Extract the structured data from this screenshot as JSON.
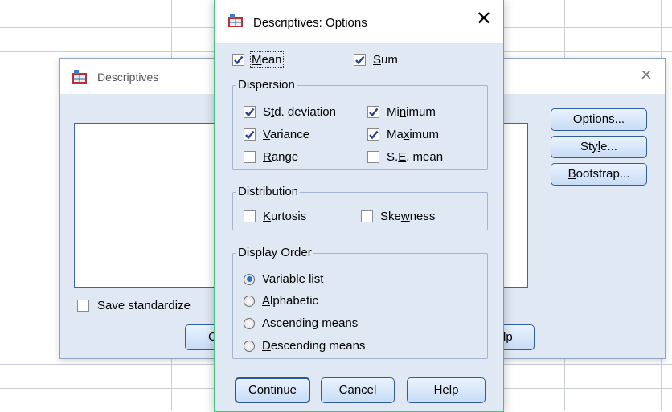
{
  "descriptives": {
    "title": "Descriptives",
    "save_standardized_label": "Save standardize",
    "buttons": {
      "options": {
        "pre": "",
        "ul": "O",
        "post": "ptions..."
      },
      "style": {
        "pre": "Sty",
        "ul": "l",
        "post": "e..."
      },
      "bootstrap": {
        "pre": "",
        "ul": "B",
        "post": "ootstrap..."
      },
      "bottom_left_partial": "C",
      "bottom_right_partial": "lp"
    }
  },
  "options_dialog": {
    "title": "Descriptives: Options",
    "mean": {
      "pre": "",
      "ul": "M",
      "post": "ean",
      "checked": true
    },
    "sum": {
      "pre": "",
      "ul": "S",
      "post": "um",
      "checked": true
    },
    "dispersion": {
      "legend": "Dispersion",
      "std_deviation": {
        "pre": "S",
        "ul": "t",
        "post": "d. deviation",
        "checked": true
      },
      "minimum": {
        "pre": "Mi",
        "ul": "n",
        "post": "imum",
        "checked": true
      },
      "variance": {
        "pre": "",
        "ul": "V",
        "post": "ariance",
        "checked": true
      },
      "maximum": {
        "pre": "Ma",
        "ul": "x",
        "post": "imum",
        "checked": true
      },
      "range": {
        "pre": "",
        "ul": "R",
        "post": "ange",
        "checked": false
      },
      "se_mean": {
        "pre": "S.",
        "ul": "E",
        "post": ". mean",
        "checked": false
      }
    },
    "distribution": {
      "legend": "Distribution",
      "kurtosis": {
        "pre": "",
        "ul": "K",
        "post": "urtosis",
        "checked": false
      },
      "skewness": {
        "pre": "Ske",
        "ul": "w",
        "post": "ness",
        "checked": false
      }
    },
    "display_order": {
      "legend": "Display Order",
      "variable_list": {
        "pre": "Varia",
        "ul": "b",
        "post": "le list",
        "selected": true
      },
      "alphabetic": {
        "pre": "",
        "ul": "A",
        "post": "lphabetic",
        "selected": false
      },
      "ascending_means": {
        "pre": "As",
        "ul": "c",
        "post": "ending means",
        "selected": false
      },
      "descending_means": {
        "pre": "",
        "ul": "D",
        "post": "escending means",
        "selected": false
      }
    },
    "buttons": {
      "continue": "Continue",
      "cancel": "Cancel",
      "help": "Help"
    }
  },
  "icons": {
    "app_icon": "spss-table-icon",
    "close": "close-icon",
    "check": "checkmark-icon"
  },
  "colors": {
    "dialog_bg": "#dfe8f3",
    "button_border": "#2e5f9a",
    "focus_border": "#3fc47e",
    "radio_dot": "#2d6fd0"
  }
}
